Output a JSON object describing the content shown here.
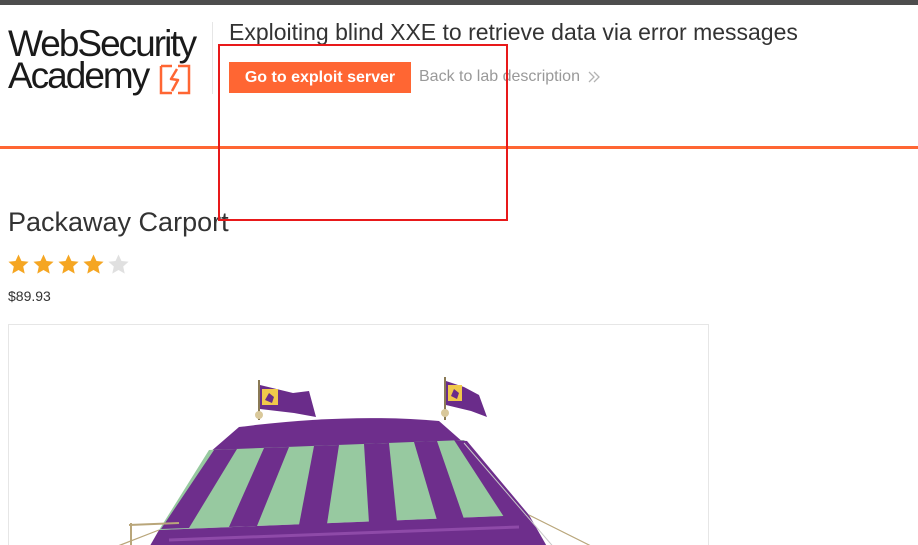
{
  "header": {
    "logo_line1": "WebSecurity",
    "logo_line2": "Academy",
    "lab_title": "Exploiting blind XXE to retrieve data via error messages",
    "exploit_button_label": "Go to exploit server",
    "back_link_label": "Back to lab description"
  },
  "product": {
    "name": "Packaway Carport",
    "rating": 4,
    "rating_max": 5,
    "price": "$89.93",
    "image_icon": "medieval-tent-image"
  },
  "colors": {
    "accent": "#ff6633",
    "top_bar": "#4d4d4d",
    "star_filled": "#f5a623",
    "star_empty": "#e0e0e0",
    "annotation": "#e8191a"
  }
}
